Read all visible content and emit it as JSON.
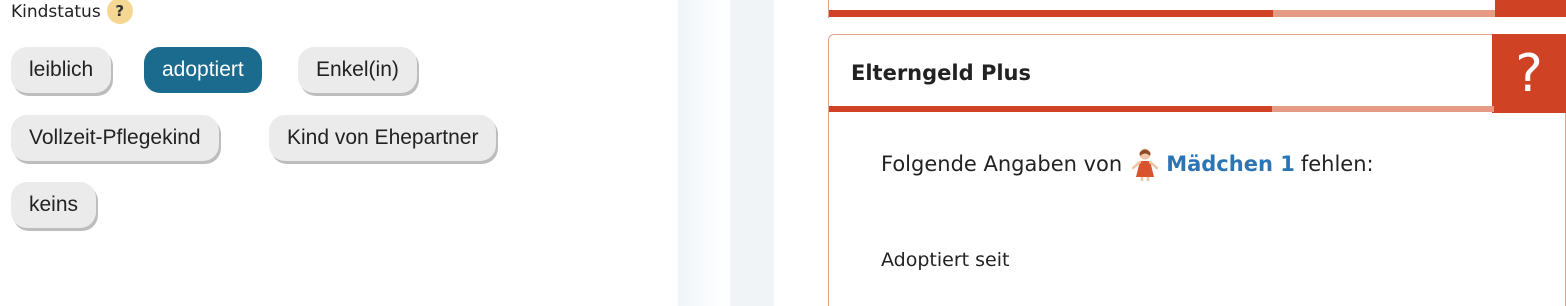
{
  "left_panel": {
    "label": "Kindstatus",
    "help_symbol": "?",
    "options": [
      {
        "label": "leiblich",
        "selected": false
      },
      {
        "label": "adoptiert",
        "selected": true
      },
      {
        "label": "Enkel(in)",
        "selected": false
      },
      {
        "label": "Vollzeit-Pflegekind",
        "selected": false
      },
      {
        "label": "Kind von Ehepartner",
        "selected": false
      },
      {
        "label": "keins",
        "selected": false
      }
    ]
  },
  "right_panel": {
    "card_title": "Elterngeld Plus",
    "help_symbol": "?",
    "missing_prefix": "Folgende Angaben von",
    "child_name": "Mädchen 1",
    "missing_suffix": "fehlen:",
    "field_label": "Adoptiert seit"
  },
  "colors": {
    "accent_red": "#cf4324",
    "accent_light": "#e59c84",
    "chip_selected": "#1b6b8e",
    "link_blue": "#2b75b5"
  },
  "icons": {
    "help": "question-mark-icon",
    "child": "girl-icon"
  }
}
